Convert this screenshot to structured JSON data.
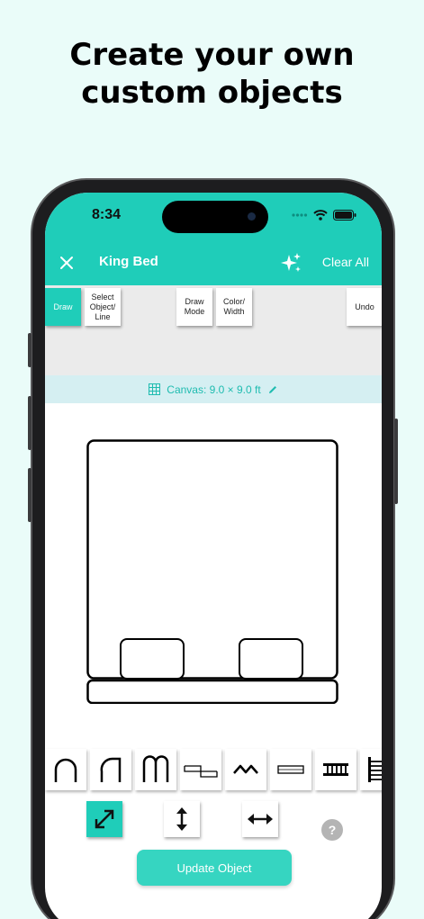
{
  "headline": {
    "line1": "Create your own",
    "line2": "custom objects"
  },
  "status_bar": {
    "time": "8:34"
  },
  "app_bar": {
    "title": "King Bed",
    "clear_all_label": "Clear All"
  },
  "toolbar": {
    "draw_label": "Draw",
    "select_label": "Select Object/ Line",
    "draw_mode_label": "Draw Mode",
    "color_width_label": "Color/ Width",
    "undo_label": "Undo"
  },
  "canvas": {
    "label": "Canvas: 9.0 × 9.0 ft"
  },
  "shape_palette": {
    "items": [
      "arch-shape",
      "quarter-arch-shape",
      "double-arch-shape",
      "step-door-shape",
      "peak-shape",
      "rectangle-shape",
      "ladder-shape",
      "vertical-ladder-shape"
    ]
  },
  "controls": {
    "items": [
      "resize-diagonal",
      "resize-vertical",
      "resize-horizontal"
    ],
    "help": "?"
  },
  "update_button": {
    "label": "Update Object"
  },
  "colors": {
    "accent": "#1fcdb9",
    "canvas_bar": "#d5eff2",
    "background": "#eafcf9"
  }
}
